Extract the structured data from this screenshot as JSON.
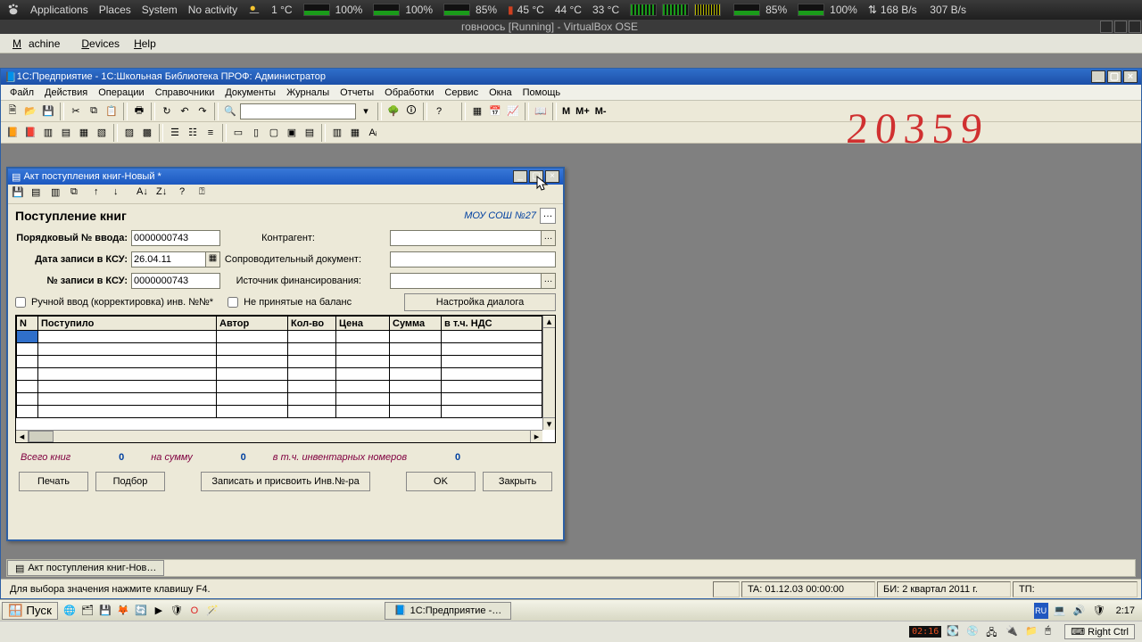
{
  "gnome": {
    "apps": "Applications",
    "places": "Places",
    "system": "System",
    "activity": "No activity",
    "temp_out": "1 °C",
    "batt1": "100%",
    "batt2": "100%",
    "batt3": "85%",
    "temp_cpu1": "45 °C",
    "temp_cpu2": "44 °C",
    "temp_cpu3": "33 °C",
    "mem": "85%",
    "swap": "100%",
    "net_down": "168 B/s",
    "net_up": "307 B/s"
  },
  "vbox": {
    "title": "говноось [Running] - VirtualBox OSE",
    "menu_machine": "Machine",
    "menu_devices": "Devices",
    "menu_help": "Help",
    "capt": "02:16",
    "rctrl": "Right Ctrl"
  },
  "onec": {
    "title": "1С:Предприятие - 1С:Школьная Библиотека ПРОФ:  Администратор",
    "menu": [
      "Файл",
      "Действия",
      "Операции",
      "Справочники",
      "Документы",
      "Журналы",
      "Отчеты",
      "Обработки",
      "Сервис",
      "Окна",
      "Помощь"
    ],
    "mx": {
      "m": "M",
      "mp": "M+",
      "mm": "M-"
    }
  },
  "doc": {
    "title": "Акт поступления книг-Новый *",
    "heading": "Поступление книг",
    "org": "МОУ СОШ №27",
    "labels": {
      "ordno": "Порядковый № ввода:",
      "date": "Дата записи в КСУ:",
      "ksu": "№ записи в КСУ:",
      "contragent": "Контрагент:",
      "sopdoc": "Сопроводительный документ:",
      "fin": "Источник финансирования:"
    },
    "values": {
      "ordno": "0000000743",
      "date": "26.04.11",
      "ksu": "0000000743",
      "contragent": "",
      "sopdoc": "",
      "fin": ""
    },
    "checks": {
      "manual": "Ручной ввод (корректировка) инв. №№*",
      "notaccepted": "Не принятые на баланс"
    },
    "dlgbtn": "Настройка диалога",
    "cols": [
      "N",
      "Поступило",
      "Автор",
      "Кол-во",
      "Цена",
      "Сумма",
      "в т.ч. НДС"
    ],
    "totals": {
      "l1": "Всего книг",
      "v1": "0",
      "l2": "на сумму",
      "v2": "0",
      "l3": "в т.ч. инвентарных номеров",
      "v3": "0"
    },
    "buttons": {
      "print": "Печать",
      "pick": "Подбор",
      "write": "Записать и присвоить Инв.№-ра",
      "ok": "OK",
      "close": "Закрыть"
    },
    "mdi_tab": "Акт поступления книг-Нов…",
    "hint": "Для выбора значения нажмите клавишу F4.",
    "status": {
      "ta": "TA: 01.12.03 00:00:00",
      "bi": "БИ: 2 квартал 2011 г.",
      "tp": "ТП:"
    }
  },
  "winbar": {
    "start": "Пуск",
    "task": "1С:Предприятие -…",
    "clock": "2:17",
    "lang": "RU"
  },
  "handwriting": "20359"
}
